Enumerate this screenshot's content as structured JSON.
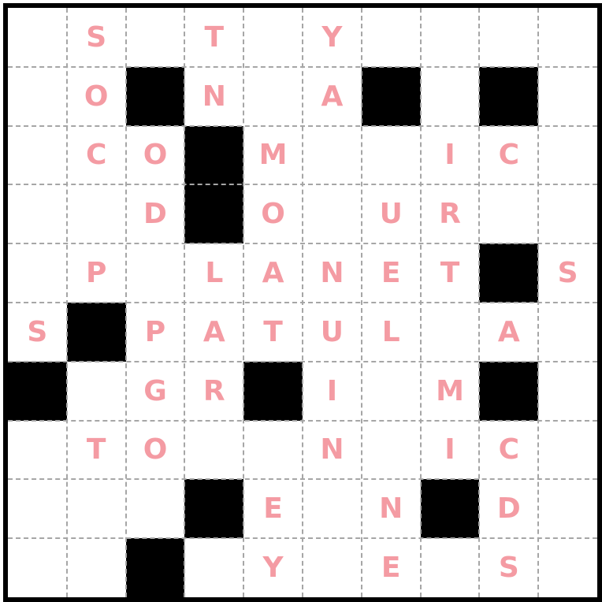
{
  "colors": {
    "letter": "#f49ba3",
    "block": "#000000",
    "grid_line": "#a6a6a6",
    "border": "#000000",
    "background": "#ffffff"
  },
  "grid": [
    [
      "",
      "S",
      "",
      "T",
      "",
      "Y",
      "",
      "",
      "",
      ""
    ],
    [
      "",
      "O",
      "#",
      "N",
      "",
      "A",
      "#",
      "",
      "#",
      ""
    ],
    [
      "",
      "C",
      "O",
      "#",
      "M",
      "",
      "",
      "I",
      "C",
      ""
    ],
    [
      "",
      "",
      "D",
      "#",
      "O",
      "",
      "U",
      "R",
      "",
      ""
    ],
    [
      "",
      "P",
      "",
      "L",
      "A",
      "N",
      "E",
      "T",
      "#",
      "S"
    ],
    [
      "S",
      "#",
      "P",
      "A",
      "T",
      "U",
      "L",
      "",
      "A",
      ""
    ],
    [
      "#",
      "",
      "G",
      "R",
      "#",
      "I",
      "",
      "M",
      "#",
      ""
    ],
    [
      "",
      "T",
      "O",
      "",
      "",
      "N",
      "",
      "I",
      "C",
      ""
    ],
    [
      "",
      "",
      "",
      "#",
      "E",
      "",
      "N",
      "#",
      "D",
      ""
    ],
    [
      "",
      "",
      "#",
      "",
      "Y",
      "",
      "E",
      "",
      "S",
      ""
    ]
  ]
}
